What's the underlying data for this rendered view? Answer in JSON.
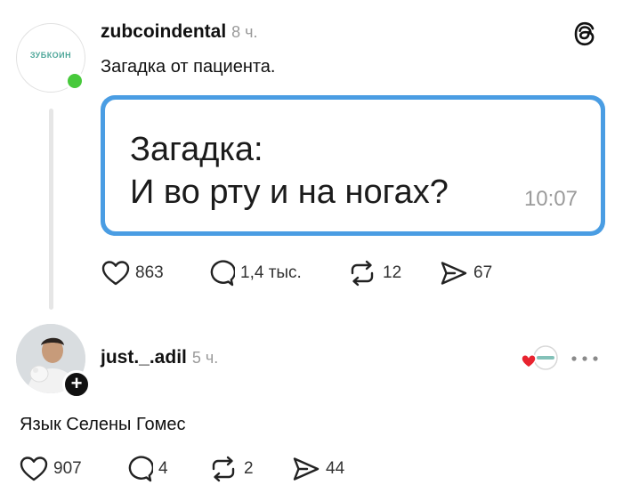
{
  "threads_logo_icon": "threads-logo-icon",
  "post1": {
    "username": "zubcoindental",
    "time": "8 ч.",
    "avatar_brand": "ЗУБКОИН",
    "text": "Загадка от пациента.",
    "quote": {
      "text": "Загадка:\nИ во рту и на ногах?",
      "time": "10:07"
    },
    "actions": {
      "likes": "863",
      "comments": "1,4 тыс.",
      "reposts": "12",
      "shares": "67"
    }
  },
  "post2": {
    "username": "just._.adil",
    "time": "5 ч.",
    "text": "Язык Селены Гомес",
    "actions": {
      "likes": "907",
      "comments": "4",
      "reposts": "2",
      "shares": "44"
    }
  },
  "colors": {
    "online": "#47c93b",
    "card_border": "#4a9de3",
    "heart_liked": "#e8232f"
  }
}
